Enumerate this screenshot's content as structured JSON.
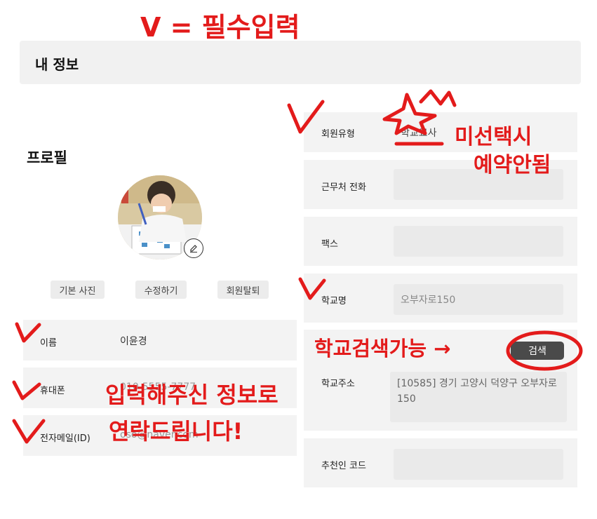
{
  "header": {
    "title": "내 정보"
  },
  "profile": {
    "title": "프로필",
    "buttons": {
      "default_photo": "기본 사진",
      "edit": "수정하기",
      "withdraw": "회원탈퇴"
    }
  },
  "left_form": {
    "name": {
      "label": "이름",
      "value": "이윤경"
    },
    "phone": {
      "label": "휴대폰",
      "value": "010-5555-7777"
    },
    "email": {
      "label": "전자메일(ID)",
      "value": "oso@naver.com"
    }
  },
  "right_form": {
    "member_type": {
      "label": "회원유형",
      "value": "학교교사"
    },
    "work_phone": {
      "label": "근무처 전화",
      "value": ""
    },
    "fax": {
      "label": "팩스",
      "value": ""
    },
    "school_name": {
      "label": "학교명",
      "value": "오부자로150"
    },
    "school_address": {
      "label": "학교주소",
      "value": "[10585] 경기 고양시 덕양구 오부자로 150",
      "search_label": "검색"
    },
    "referrer_code": {
      "label": "추천인 코드",
      "value": ""
    }
  },
  "annotations": {
    "legend": "V = 필수입력",
    "member_type_note_line1": "미선택시",
    "member_type_note_line2": "예약안됨",
    "school_search_note": "학교검색가능 →",
    "contact_note_line1": "입력해주신 정보로",
    "contact_note_line2": "연락드립니다!"
  },
  "colors": {
    "annotation_red": "#e31b1b",
    "search_button": "#4a4a4a"
  }
}
